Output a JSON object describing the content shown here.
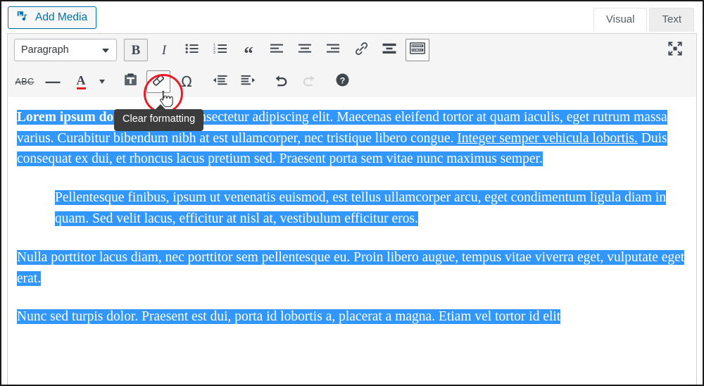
{
  "window": {
    "app": "WordPress Classic Editor"
  },
  "topbar": {
    "add_media_label": "Add Media",
    "add_media_icon": "media-icon",
    "tabs": [
      {
        "label": "Visual",
        "active": true
      },
      {
        "label": "Text",
        "active": false
      }
    ]
  },
  "toolbar": {
    "row1": {
      "style_select": {
        "value": "Paragraph",
        "caret_icon": "chevron-down-icon"
      },
      "buttons": [
        {
          "name": "bold",
          "glyph": "B",
          "title": "Bold",
          "active": true
        },
        {
          "name": "italic",
          "glyph": "I",
          "title": "Italic",
          "active": false
        },
        {
          "name": "bulleted-list",
          "glyph": "",
          "title": "Bulleted list",
          "active": false
        },
        {
          "name": "numbered-list",
          "glyph": "",
          "title": "Numbered list",
          "active": false
        },
        {
          "name": "blockquote",
          "glyph": "“",
          "title": "Blockquote",
          "active": false
        },
        {
          "name": "align-left",
          "glyph": "",
          "title": "Align left",
          "active": false
        },
        {
          "name": "align-center",
          "glyph": "",
          "title": "Align center",
          "active": false
        },
        {
          "name": "align-right",
          "glyph": "",
          "title": "Align right",
          "active": false
        },
        {
          "name": "insert-link",
          "glyph": "",
          "title": "Insert/edit link",
          "active": false
        },
        {
          "name": "read-more",
          "glyph": "",
          "title": "Insert Read More tag",
          "active": false
        },
        {
          "name": "toolbar-toggle",
          "glyph": "",
          "title": "Toolbar Toggle",
          "active": true
        }
      ],
      "fullscreen": {
        "name": "distraction-free-writing",
        "title": "Distraction-free writing mode"
      }
    },
    "row2": {
      "buttons": [
        {
          "name": "strikethrough",
          "glyph": "ABC",
          "title": "Strikethrough",
          "active": false
        },
        {
          "name": "horizontal-line",
          "glyph": "—",
          "title": "Horizontal line",
          "active": false
        },
        {
          "name": "text-color",
          "glyph": "A",
          "title": "Text color",
          "active": false,
          "swatch": "#e02020"
        },
        {
          "name": "text-color-dropdown",
          "glyph": "",
          "title": "Text color options",
          "active": false
        },
        {
          "name": "paste-as-text",
          "glyph": "",
          "title": "Paste as text",
          "active": false
        },
        {
          "name": "clear-formatting",
          "glyph": "",
          "title": "Clear formatting",
          "active": true
        },
        {
          "name": "special-character",
          "glyph": "Ω",
          "title": "Special character",
          "active": false
        },
        {
          "name": "decrease-indent",
          "glyph": "",
          "title": "Decrease indent",
          "active": false
        },
        {
          "name": "increase-indent",
          "glyph": "",
          "title": "Increase indent",
          "active": false
        },
        {
          "name": "undo",
          "glyph": "",
          "title": "Undo",
          "active": false
        },
        {
          "name": "redo",
          "glyph": "",
          "title": "Redo",
          "active": false,
          "disabled": true
        },
        {
          "name": "keyboard-shortcuts",
          "glyph": "?",
          "title": "Keyboard Shortcuts",
          "active": false
        }
      ]
    }
  },
  "annotation": {
    "tooltip_text": "Clear formatting",
    "highlight_shape": "red-circle",
    "highlight_color": "#ee1b24",
    "cursor_icon": "pointer-hand-cursor"
  },
  "colors": {
    "selection_highlight": "#3297fd",
    "selection_text": "#ffffff",
    "accent_link": "#0073aa",
    "tooltip_bg": "#3c3c3c"
  },
  "content": {
    "paragraphs": [
      {
        "id": "p1",
        "indented": false,
        "selected": true,
        "runs": [
          {
            "text": "Lorem ipsum dolor sit amet,",
            "bold": true
          },
          {
            "text": " consectetur adipiscing elit. Maecenas eleifend tortor at quam iaculis, eget rutrum massa varius. Curabitur bibendum nibh at est ullamcorper, nec tristique libero congue. "
          },
          {
            "text": "Integer semper vehicula lobortis.",
            "link": true
          },
          {
            "text": " Duis consequat ex dui, et rhoncus lacus pretium sed. Praesent porta sem vitae nunc maximus semper."
          }
        ]
      },
      {
        "id": "p2",
        "indented": true,
        "selected": true,
        "runs": [
          {
            "text": "Pellentesque finibus, ipsum ut venenatis euismod, est tellus ullamcorper arcu, eget condimentum ligula diam in quam. Sed velit lacus, efficitur at nisl at, vestibulum efficitur eros."
          }
        ]
      },
      {
        "id": "p3",
        "indented": false,
        "selected": true,
        "runs": [
          {
            "text": "Nulla porttitor lacus diam, nec porttitor sem pellentesque eu. Proin libero augue, tempus vitae viverra eget, vulputate eget erat."
          }
        ]
      },
      {
        "id": "p4",
        "indented": false,
        "selected": true,
        "runs": [
          {
            "text": "Nunc sed turpis dolor. Praesent est dui, porta id lobortis a, placerat a magna. Etiam vel tortor id elit"
          }
        ]
      }
    ]
  }
}
